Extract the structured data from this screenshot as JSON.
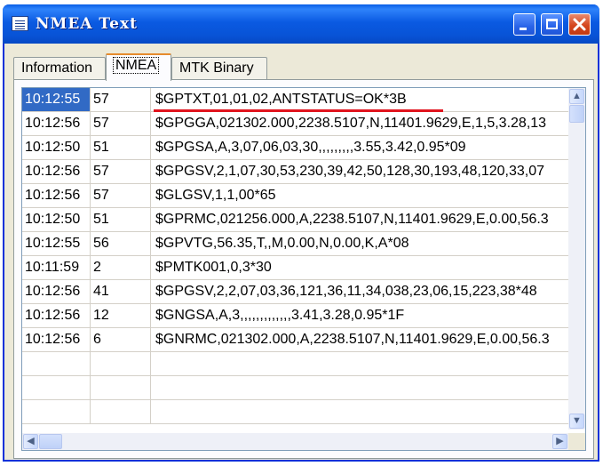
{
  "window": {
    "title": "NMEA Text",
    "colors": {
      "titlebar": "#0a5ae2",
      "selection": "#316ac5",
      "annotation": "#e1141e"
    }
  },
  "tabs": [
    {
      "label": "Information",
      "active": false
    },
    {
      "label": "NMEA",
      "active": true
    },
    {
      "label": "MTK Binary",
      "active": false
    }
  ],
  "rows": [
    {
      "time": "10:12:55",
      "length": "57",
      "sentence": "$GPTXT,01,01,02,ANTSTATUS=OK*3B",
      "selected": true
    },
    {
      "time": "10:12:56",
      "length": "57",
      "sentence": "$GPGGA,021302.000,2238.5107,N,11401.9629,E,1,5,3.28,13"
    },
    {
      "time": "10:12:50",
      "length": "51",
      "sentence": "$GPGSA,A,3,07,06,03,30,,,,,,,,,3.55,3.42,0.95*09"
    },
    {
      "time": "10:12:56",
      "length": "57",
      "sentence": "$GPGSV,2,1,07,30,53,230,39,42,50,128,30,193,48,120,33,07"
    },
    {
      "time": "10:12:56",
      "length": "57",
      "sentence": "$GLGSV,1,1,00*65"
    },
    {
      "time": "10:12:50",
      "length": "51",
      "sentence": "$GPRMC,021256.000,A,2238.5107,N,11401.9629,E,0.00,56.3"
    },
    {
      "time": "10:12:55",
      "length": "56",
      "sentence": "$GPVTG,56.35,T,,M,0.00,N,0.00,K,A*08"
    },
    {
      "time": "10:11:59",
      "length": "2",
      "sentence": "$PMTK001,0,3*30"
    },
    {
      "time": "10:12:56",
      "length": "41",
      "sentence": "$GPGSV,2,2,07,03,36,121,36,11,34,038,23,06,15,223,38*48"
    },
    {
      "time": "10:12:56",
      "length": "12",
      "sentence": "$GNGSA,A,3,,,,,,,,,,,,,3.41,3.28,0.95*1F"
    },
    {
      "time": "10:12:56",
      "length": "6",
      "sentence": "$GNRMC,021302.000,A,2238.5107,N,11401.9629,E,0.00,56.3"
    },
    {
      "time": "",
      "length": "",
      "sentence": ""
    },
    {
      "time": "",
      "length": "",
      "sentence": ""
    },
    {
      "time": "",
      "length": "",
      "sentence": ""
    }
  ],
  "icons": {
    "app": "text-document-icon",
    "minimize": "minimize-icon",
    "maximize": "maximize-icon",
    "close": "close-icon"
  }
}
